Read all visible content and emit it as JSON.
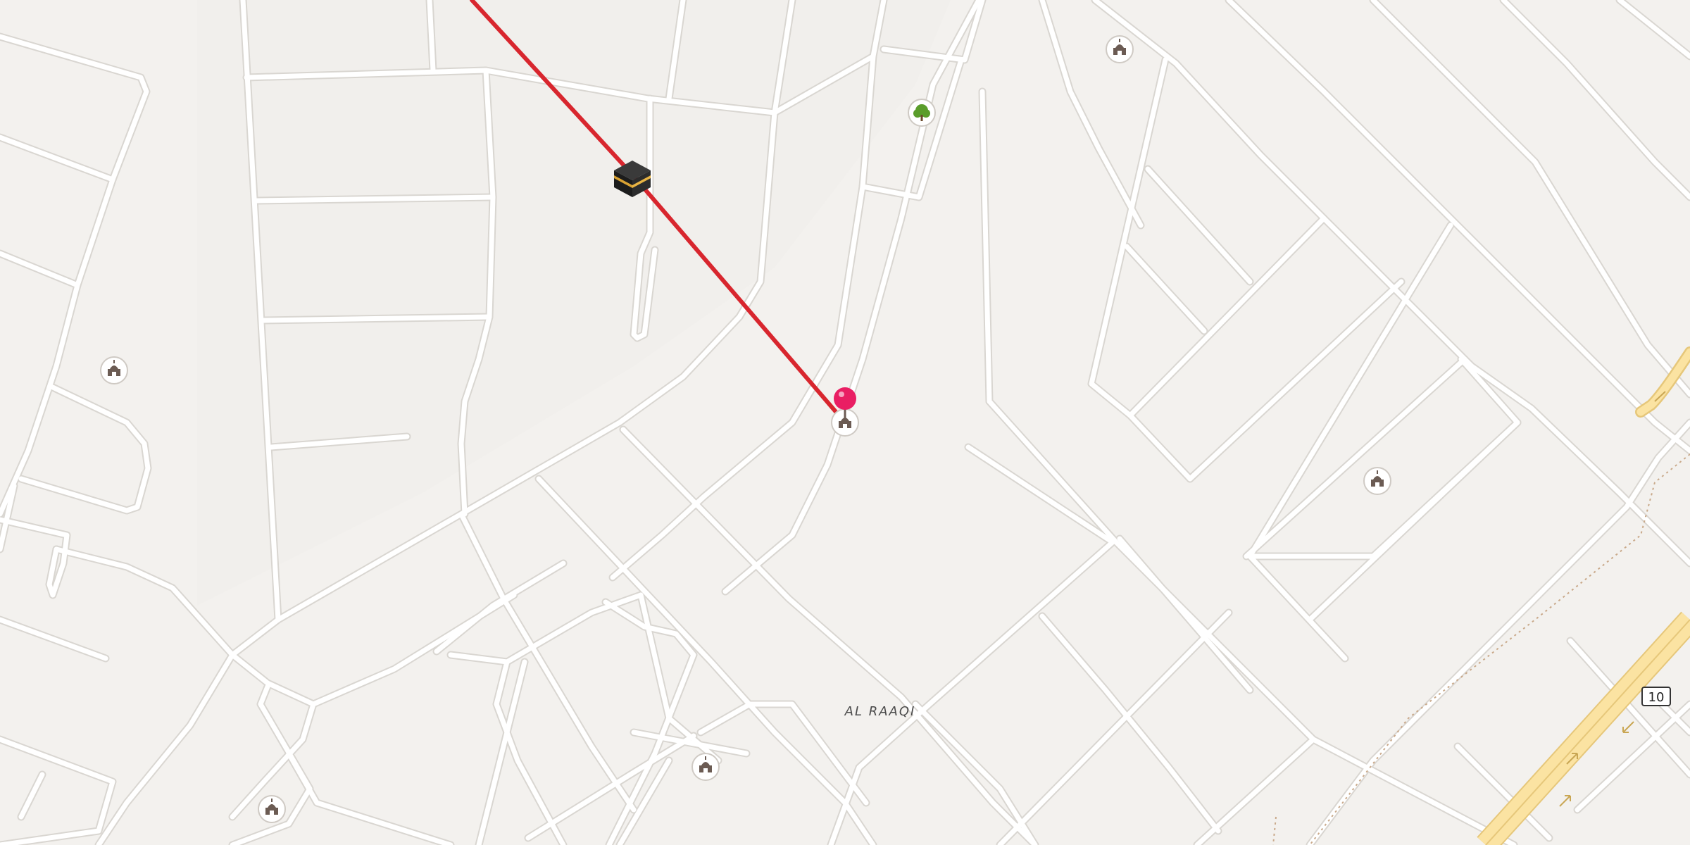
{
  "map": {
    "district_label": "AL RAAQI",
    "route_shield": "10",
    "colors": {
      "background": "#f3f1ee",
      "block": "#f5f3f0",
      "road": "#ffffff",
      "road_outline": "#d9d6d1",
      "highway": "#fbe3a2",
      "highway_outline": "#e6c77a",
      "route_line": "#d8262e",
      "pin": "#e91e63",
      "poi_ring": "#ffffff",
      "poi_icon": "#6b5b53",
      "park_icon": "#5a9d2b"
    },
    "poi_icons": [
      "mosque-icon",
      "mosque-icon",
      "mosque-icon",
      "mosque-icon",
      "mosque-icon",
      "mosque-icon",
      "park-icon",
      "kaaba-icon",
      "location-pin-icon"
    ]
  }
}
